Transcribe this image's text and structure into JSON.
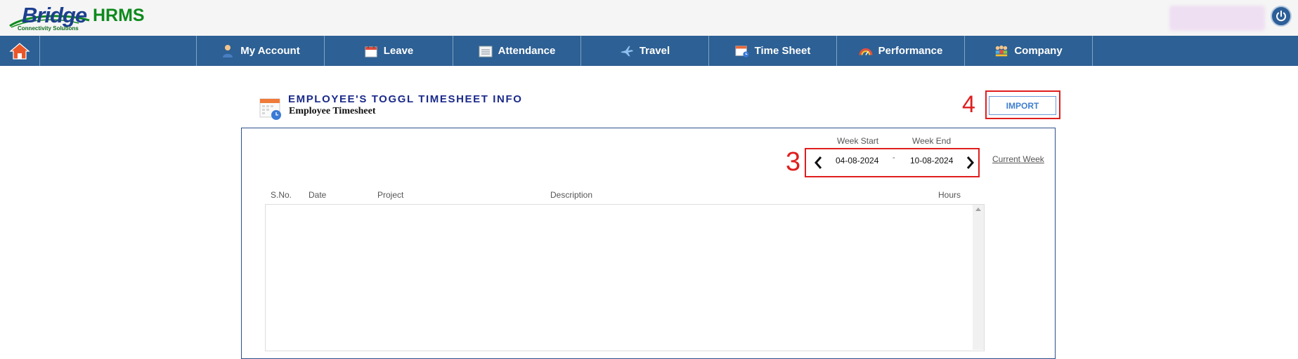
{
  "app": {
    "logo_main": "Bridge",
    "logo_product": "HRMS",
    "logo_tagline": "Connectivity Solutions"
  },
  "icons": {
    "home": "home-icon",
    "power": "power-icon",
    "my_account": "person-icon",
    "leave": "calendar-icon",
    "attendance": "attendance-icon",
    "travel": "airplane-icon",
    "time_sheet": "calendar-clock-icon",
    "performance": "gauge-icon",
    "company": "team-icon"
  },
  "nav": {
    "items": [
      {
        "label": "My Account"
      },
      {
        "label": "Leave"
      },
      {
        "label": "Attendance"
      },
      {
        "label": "Travel"
      },
      {
        "label": "Time Sheet"
      },
      {
        "label": "Performance"
      },
      {
        "label": "Company"
      }
    ]
  },
  "page": {
    "title": "EMPLOYEE'S TOGGL TIMESHEET INFO",
    "subtitle": "Employee Timesheet",
    "import_label": "IMPORT",
    "annotation_import": "4",
    "annotation_week": "3"
  },
  "week": {
    "start_label": "Week Start",
    "end_label": "Week End",
    "start_value": "04-08-2024",
    "separator": "-",
    "end_value": "10-08-2024",
    "current_week_label": "Current Week"
  },
  "table": {
    "columns": [
      "S.No.",
      "Date",
      "Project",
      "Description",
      "Hours"
    ],
    "rows": []
  },
  "colors": {
    "nav_bg": "#2d6094",
    "annotation_red": "#e01e1e",
    "title_blue": "#1a2a8a",
    "logo_green": "#0e8a1d"
  }
}
